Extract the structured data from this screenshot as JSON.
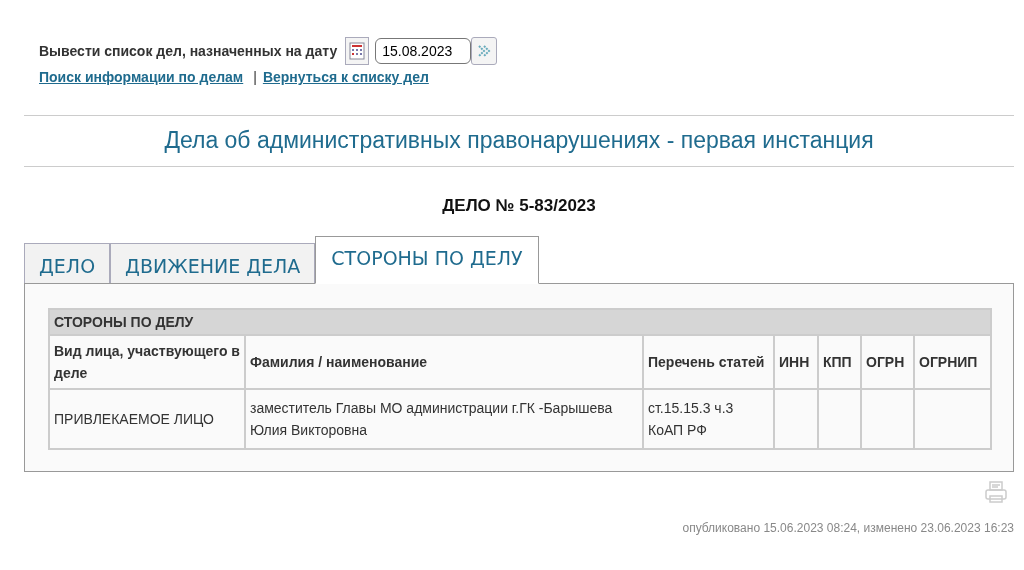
{
  "date_filter": {
    "label": "Вывести список дел, назначенных на дату",
    "value": "15.08.2023"
  },
  "links": [
    "Поиск информации по делам",
    "Вернуться к списку дел"
  ],
  "link_separator": "|",
  "heading": "Дела об административных правонарушениях - первая инстанция",
  "case_number": "ДЕЛО № 5-83/2023",
  "tabs": [
    {
      "label": "ДЕЛО",
      "selected": false
    },
    {
      "label": "ДВИЖЕНИЕ ДЕЛА",
      "selected": false
    },
    {
      "label": "СТОРОНЫ ПО ДЕЛУ",
      "selected": true
    }
  ],
  "table": {
    "caption": "СТОРОНЫ ПО ДЕЛУ",
    "columns": [
      "Вид лица, участвующего в деле",
      "Фамилия / наименование",
      "Перечень статей",
      "ИНН",
      "КПП",
      "ОГРН",
      "ОГРНИП"
    ],
    "rows": [
      {
        "role": "ПРИВЛЕКАЕМОЕ ЛИЦО",
        "name": "заместитель Главы МО администрации г.ГК -Барышева Юлия Викторовна",
        "articles": "ст.15.15.3 ч.3 КоАП РФ"
      }
    ]
  },
  "footer": "опубликовано 15.06.2023 08:24, изменено 23.06.2023 16:23"
}
